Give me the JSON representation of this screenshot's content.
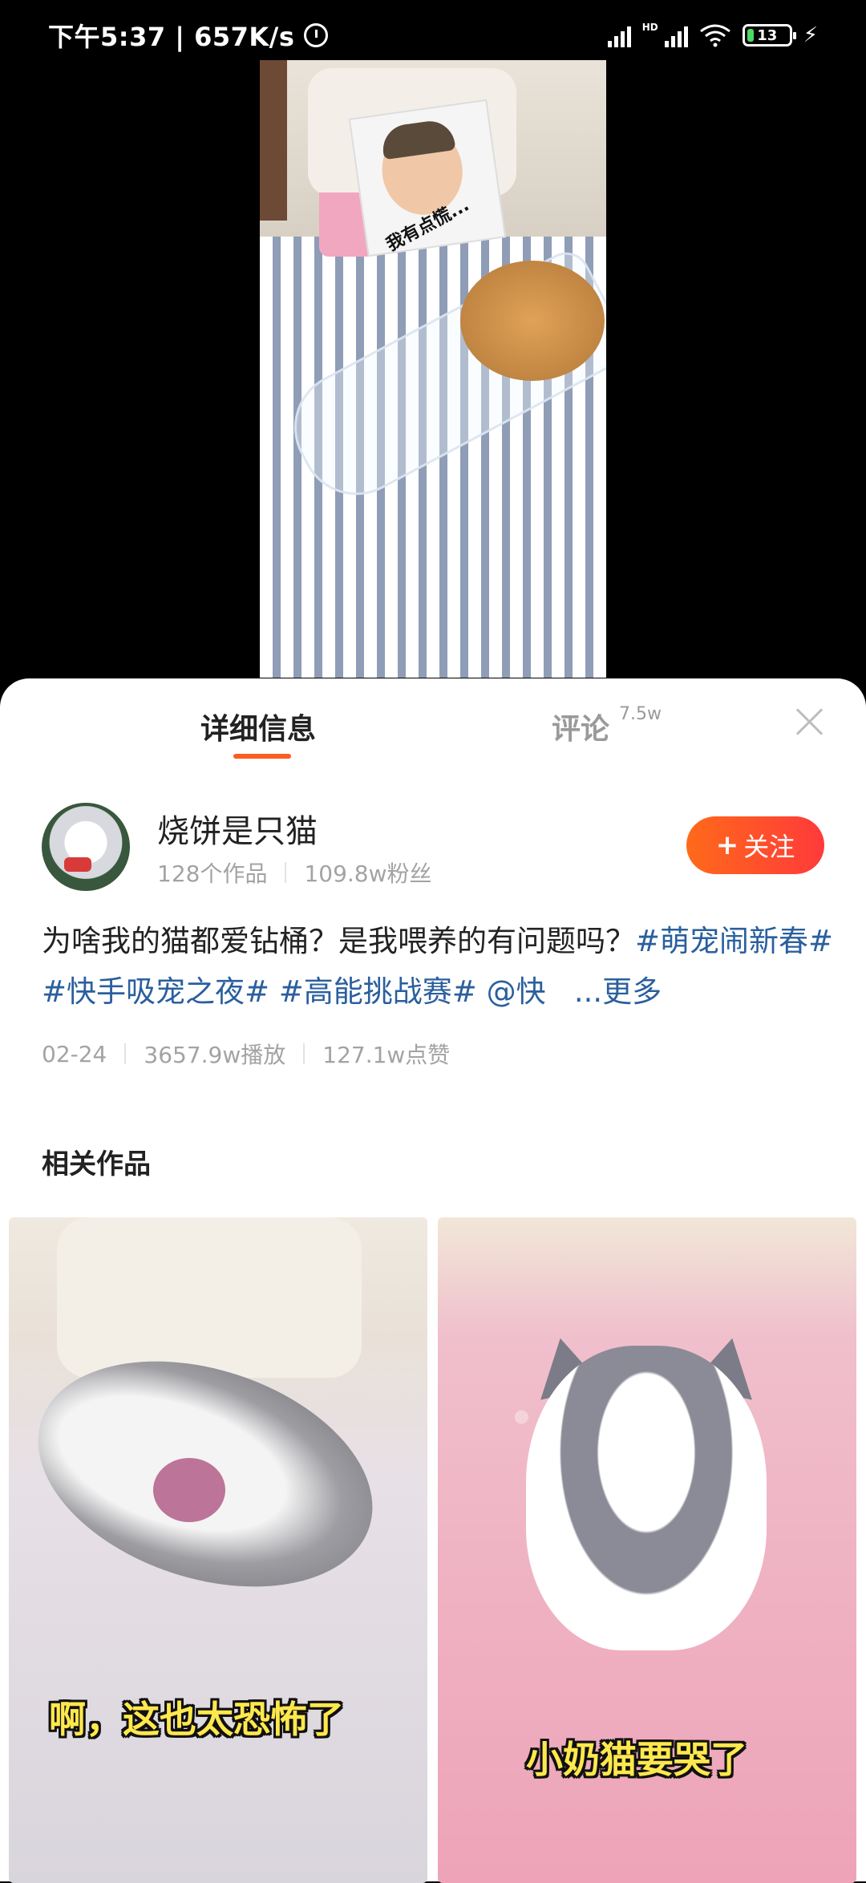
{
  "status_bar": {
    "time": "下午5:37",
    "speed": "657K/s",
    "hd": "HD",
    "battery": "13",
    "battery_level_percent": 13
  },
  "video": {
    "sticker_text": "我有点慌..."
  },
  "tabs": {
    "detail": "详细信息",
    "comments": "评论",
    "comments_count": "7.5w"
  },
  "author": {
    "name": "烧饼是只猫",
    "works": "128个作品",
    "fans": "109.8w粉丝",
    "follow": "关注",
    "follow_plus": "+"
  },
  "description": {
    "text_part1": "为啥我的猫都爱钻桶？是我喂养的有问题吗？",
    "tag1": "#萌宠闹新春#",
    "tag2": "#快手吸宠之夜#",
    "tag3": "#高能挑战赛#",
    "mention": "@快",
    "more": "...更多"
  },
  "meta": {
    "date": "02-24",
    "plays": "3657.9w播放",
    "likes": "127.1w点赞"
  },
  "related": {
    "title": "相关作品",
    "items": [
      {
        "caption": "啊，这也太恐怖了"
      },
      {
        "caption": "小奶猫要哭了"
      }
    ]
  },
  "colors": {
    "accent": "#ff5a1f",
    "tag_blue": "#2a5f9e",
    "follow_gradient_start": "#ff6a1a",
    "follow_gradient_end": "#ff3a3a"
  }
}
